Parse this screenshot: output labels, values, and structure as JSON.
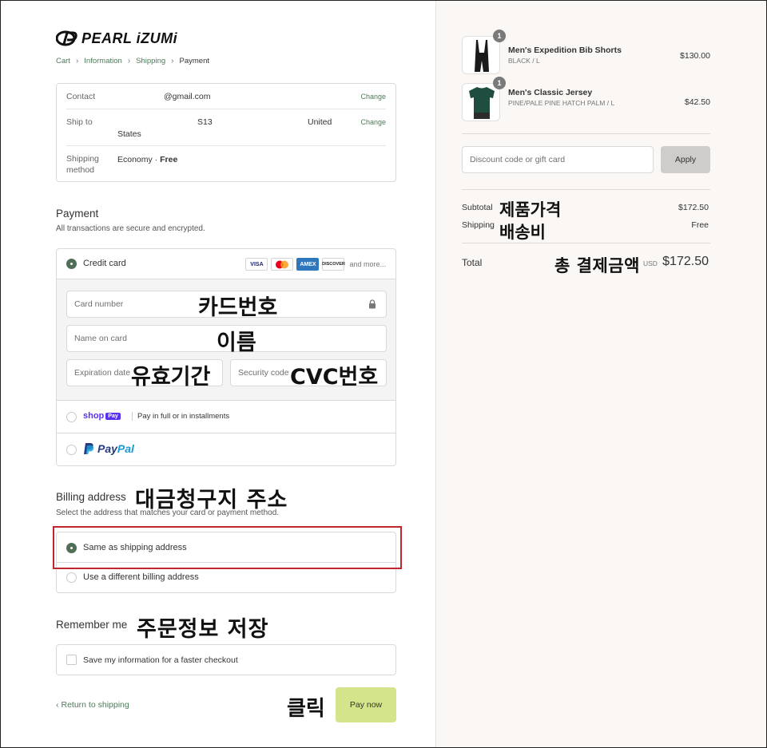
{
  "brand": {
    "name": "PEARL iZUMi"
  },
  "breadcrumb": [
    {
      "label": "Cart"
    },
    {
      "label": "Information"
    },
    {
      "label": "Shipping"
    },
    {
      "label": "Payment"
    }
  ],
  "review": {
    "contact_label": "Contact",
    "contact_value": "@gmail.com",
    "ship_label": "Ship to",
    "ship_value_a": "S13",
    "ship_value_b": "United",
    "ship_value_c": "States",
    "method_label_1": "Shipping",
    "method_label_2": "method",
    "method_value": "Economy · ",
    "method_free": "Free",
    "change_label": "Change"
  },
  "payment": {
    "title": "Payment",
    "subtitle": "All transactions are secure and encrypted.",
    "credit_card_label": "Credit card",
    "card_brands": [
      "VISA",
      "",
      "AMEX",
      "DISCOVER"
    ],
    "and_more": "and more...",
    "card_number_placeholder": "Card number",
    "name_placeholder": "Name on card",
    "expiration_placeholder": "Expiration date",
    "security_placeholder": "Security code",
    "shop_logo": "shop",
    "shop_pay_badge": "Pay",
    "shop_pay_text": "Pay in full or in installments",
    "paypal_a": "Pay",
    "paypal_b": "Pal"
  },
  "billing": {
    "title": "Billing address",
    "subtitle": "Select the address that matches your card or payment method.",
    "same": "Same as shipping address",
    "different": "Use a different billing address"
  },
  "remember": {
    "title": "Remember me",
    "save_label": "Save my information for a faster checkout"
  },
  "actions": {
    "return_label": "Return to shipping",
    "pay_now": "Pay now"
  },
  "annotations": {
    "card_number": "카드번호",
    "name": "이름",
    "expiry": "유효기간",
    "cvc": "CVC번호",
    "billing": "대금청구지 주소",
    "remember": "주문정보 저장",
    "click": "클릭",
    "subtotal": "제품가격",
    "shipping": "배송비",
    "total": "총 결제금액"
  },
  "cart": {
    "items": [
      {
        "name": "Men's Expedition Bib Shorts",
        "variant": "BLACK / L",
        "price": "$130.00",
        "qty": "1"
      },
      {
        "name": "Men's Classic Jersey",
        "variant": "PINE/PALE PINE HATCH PALM / L",
        "price": "$42.50",
        "qty": "1"
      }
    ],
    "discount_placeholder": "Discount code or gift card",
    "apply_label": "Apply",
    "subtotal_label": "Subtotal",
    "subtotal_value": "$172.50",
    "shipping_label": "Shipping",
    "shipping_value": "Free",
    "total_label": "Total",
    "currency": "USD",
    "total_value": "$172.50"
  },
  "colors": {
    "link_green": "#4d7a5a",
    "radio_green": "#4f6f57",
    "pay_button": "#d3e48a",
    "highlight_red": "#c0272d",
    "summary_bg": "#faf7f4"
  }
}
